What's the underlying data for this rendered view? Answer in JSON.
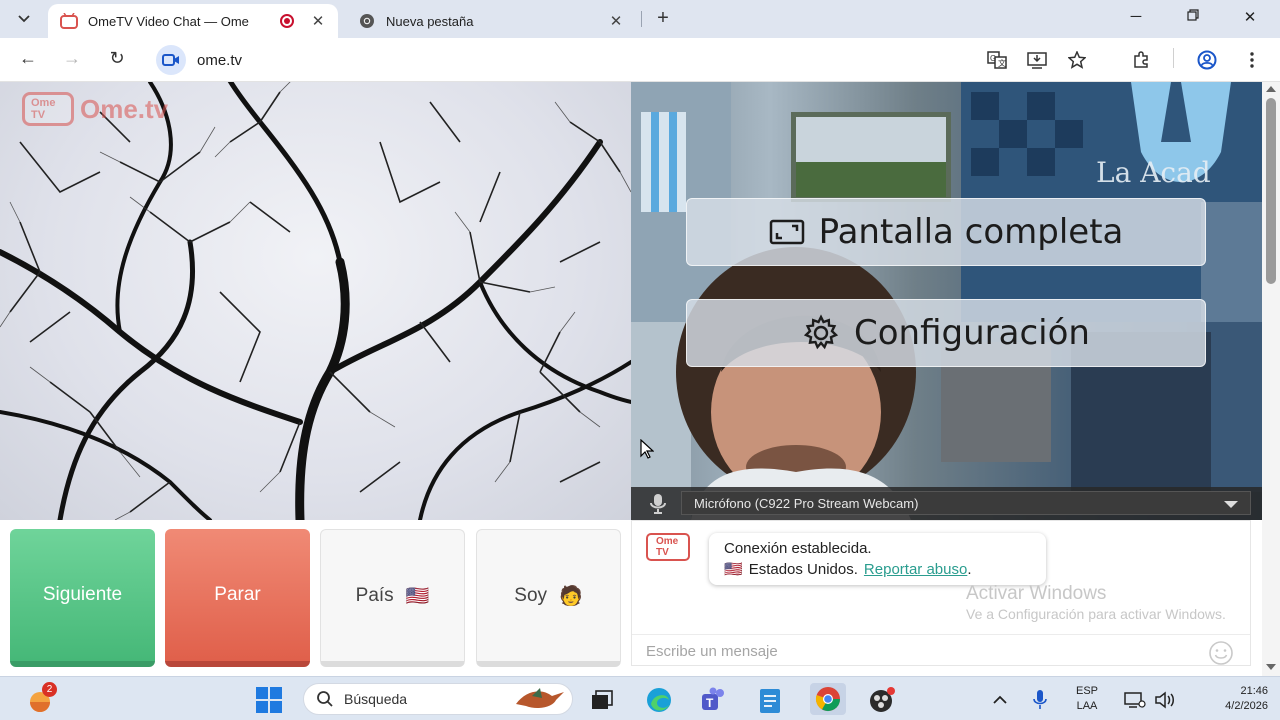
{
  "browser": {
    "tabs": [
      {
        "title": "OmeTV Video Chat — Ome",
        "active": true,
        "recording": true
      },
      {
        "title": "Nueva pestaña",
        "active": false
      }
    ],
    "url": "ome.tv"
  },
  "page": {
    "logo_text": "Ome.tv",
    "logo_badge": "Ome TV",
    "overlay": {
      "fullscreen_label": "Pantalla completa",
      "settings_label": "Configuración"
    },
    "microphone": {
      "selected": "Micrófono (C922 Pro Stream Webcam)"
    },
    "controls": {
      "next_label": "Siguiente",
      "stop_label": "Parar",
      "country_label": "País",
      "country_flag": "🇺🇸",
      "gender_label": "Soy",
      "gender_emoji": "🧑"
    },
    "chat": {
      "status_line": "Conexión establecida.",
      "country_flag": "🇺🇸",
      "country_text": "Estados Unidos.",
      "report_link": "Reportar abuso",
      "report_suffix": ".",
      "message_placeholder": "Escribe un mensaje",
      "logo_badge": "Ome TV"
    },
    "watermark": {
      "title": "Activar Windows",
      "subtitle": "Ve a Configuración para activar Windows."
    }
  },
  "taskbar": {
    "weather_badge": "2",
    "search_placeholder": "Búsqueda",
    "language": "ESP",
    "layout": "LAA",
    "time": "21:46",
    "date": "4/2/2026"
  },
  "colors": {
    "next": "#46b878",
    "stop": "#e0604b",
    "link": "#2a9d8f",
    "logo": "#d9534f"
  }
}
